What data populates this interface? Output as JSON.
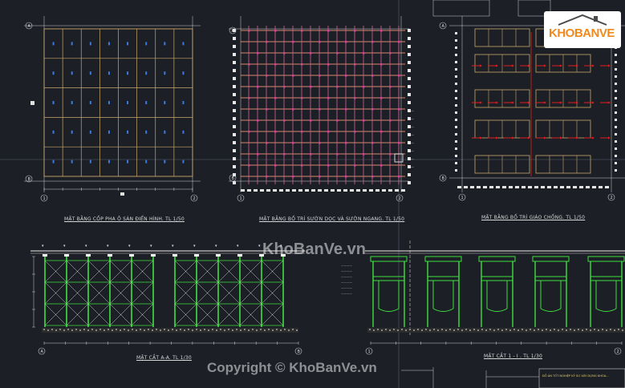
{
  "plans": {
    "formwork_title": "MẶT BẰNG CỐP PHA Ô SÀN ĐIỂN HÌNH. TL 1/50",
    "ribs_title": "MẶT BẰNG BỐ TRÍ SƯỜN DỌC VÀ SƯỜN NGANG. TL 1/50",
    "shoring_title": "MẶT BẰNG BỐ TRÍ GIÁO CHỐNG. TL 1/50"
  },
  "sections": {
    "section_aa_title": "MẶT CẮT A-A. TL 1/30",
    "section_11_title": "MẶT CẮT 1 - I . TL 1/30"
  },
  "titleblock": {
    "note": "ĐỒ ÁN TỐT NGHIỆP KỸ SƯ XÂY DỰNG KHÓA..."
  },
  "watermark": {
    "center": "KhoBanVe.vn",
    "copyright": "Copyright © KhoBanVe.vn",
    "logo_text": "KHOBANVE"
  },
  "grid_labels": {
    "axis_a": "A",
    "axis_b": "B",
    "axis_1": "1",
    "axis_2": "2"
  },
  "colors": {
    "background": "#1c1f26",
    "formwork": "#c8a86a",
    "rib_long": "#d6629a",
    "rib_cross": "#d88a6a",
    "scaffold": "#3ee03e",
    "brace": "#cfcfcf",
    "red_arrow": "#e02020",
    "logo_accent": "#f08a1c"
  }
}
